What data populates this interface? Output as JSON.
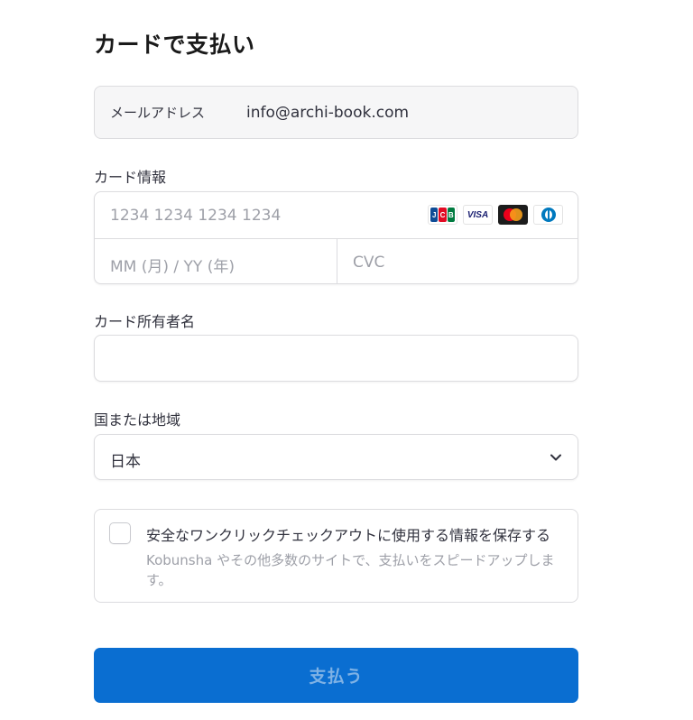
{
  "page": {
    "title": "カードで支払い"
  },
  "email": {
    "label": "メールアドレス",
    "value": "info@archi-book.com"
  },
  "card": {
    "label": "カード情報",
    "number_placeholder": "1234 1234 1234 1234",
    "expiry_placeholder": "MM (月) / YY (年)",
    "cvc_placeholder": "CVC",
    "brands": [
      "jcb-logo",
      "visa-logo",
      "mastercard-logo",
      "diners-logo"
    ],
    "brand_text": {
      "jcb_j": "J",
      "jcb_c": "C",
      "jcb_b": "B",
      "visa": "VISA"
    }
  },
  "cardholder": {
    "label": "カード所有者名",
    "value": ""
  },
  "country": {
    "label": "国または地域",
    "selected": "日本"
  },
  "save_info": {
    "title": "安全なワンクリックチェックアウトに使用する情報を保存する",
    "description": "Kobunsha やその他多数のサイトで、支払いをスピードアップします。",
    "checked": false
  },
  "pay_button": {
    "label": "支払う"
  },
  "colors": {
    "primary": "#0a6ed1",
    "button_text": "#7fb2e5",
    "border": "#dcdcdf",
    "placeholder": "#9ea0a8",
    "jcb_blue": "#0e4c96",
    "jcb_red": "#e20b24",
    "jcb_green": "#007b40",
    "mc_red": "#eb001b",
    "mc_orange": "#f79e1b"
  }
}
